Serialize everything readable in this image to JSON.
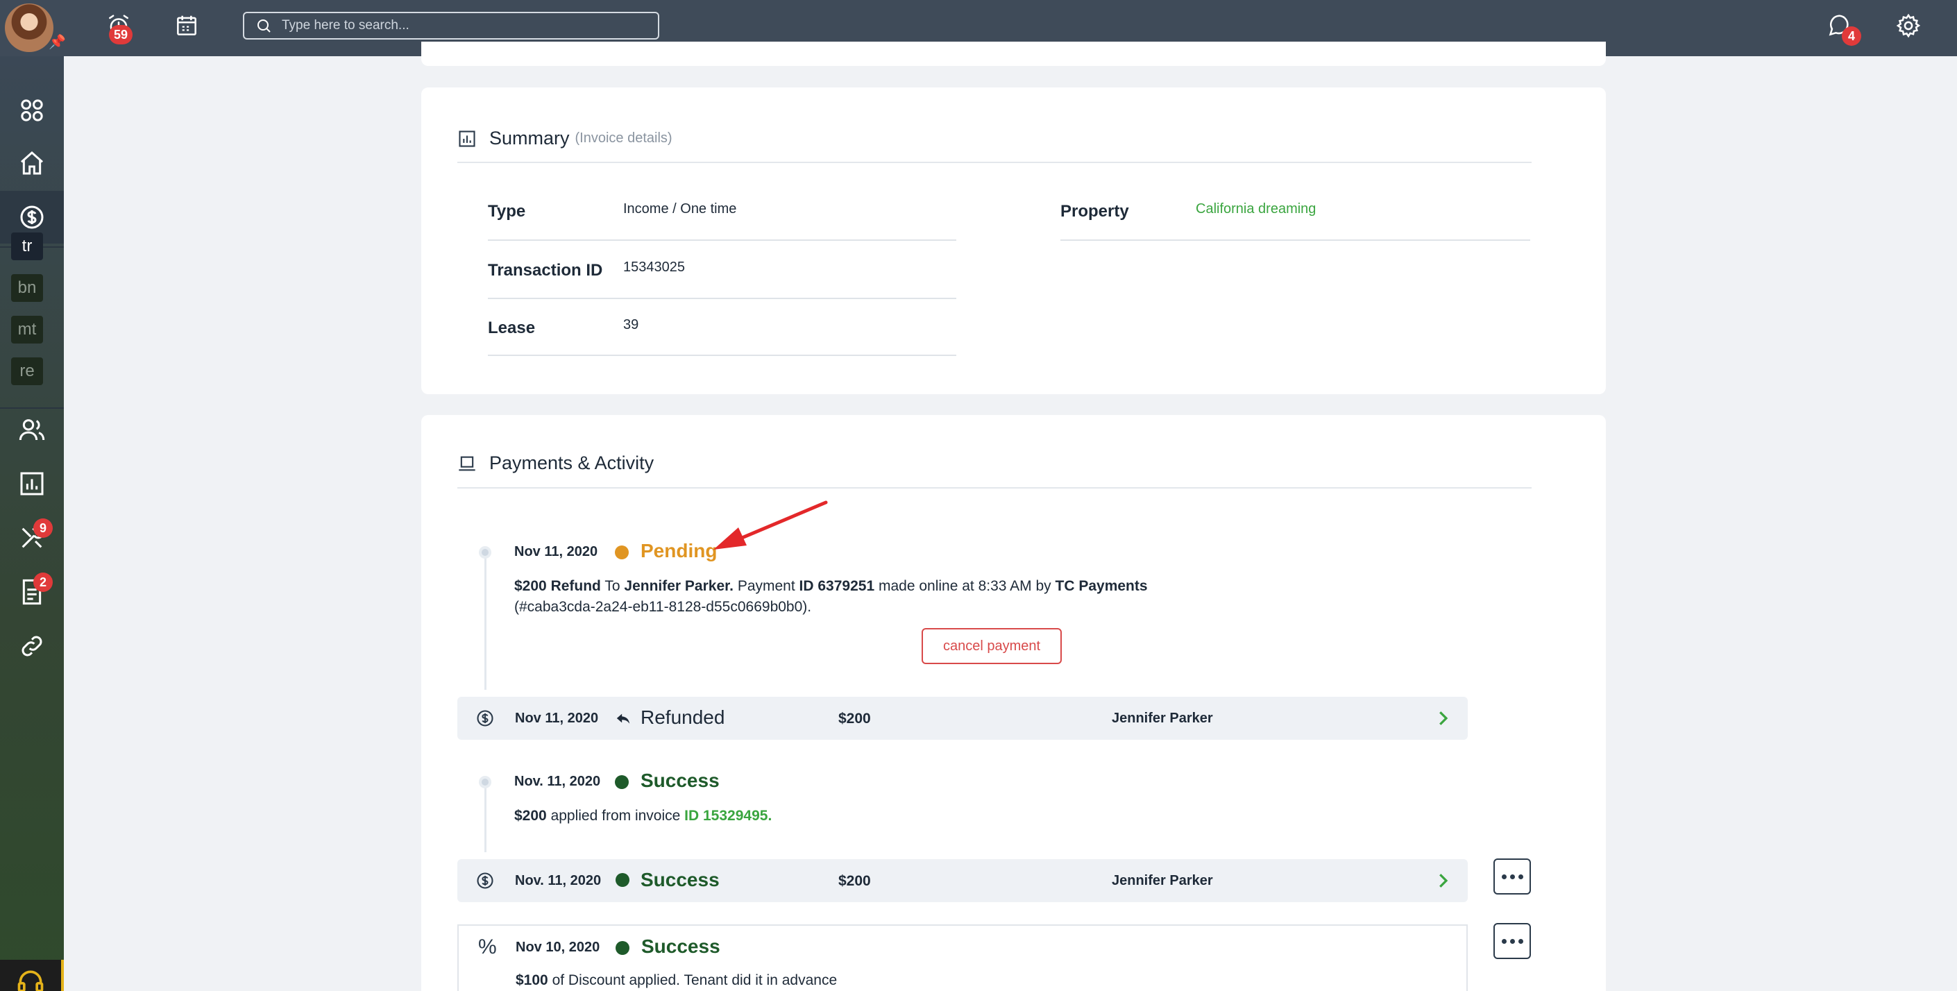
{
  "topbar": {
    "alerts_badge": "59",
    "messages_badge": "4",
    "search_placeholder": "Type here to search..."
  },
  "sidebar": {
    "shortcuts": [
      "tr",
      "bn",
      "mt",
      "re"
    ],
    "maintenance_badge": "9",
    "documents_badge": "2"
  },
  "summary": {
    "title": "Summary",
    "subtitle": "(Invoice details)",
    "type_label": "Type",
    "type_value": "Income / One time",
    "transaction_label": "Transaction ID",
    "transaction_value": "15343025",
    "lease_label": "Lease",
    "lease_value": "39",
    "property_label": "Property",
    "property_value": "California dreaming"
  },
  "payments": {
    "title": "Payments & Activity",
    "pending": {
      "date": "Nov 11, 2020",
      "status": "Pending",
      "amount": "$200",
      "kind": "Refund",
      "to_word": "To",
      "person": "Jennifer Parker.",
      "payment_word": "Payment",
      "payment_id": "ID 6379251",
      "made_text": "made online at 8:33 AM by",
      "processor": "TC Payments",
      "reference": "(#caba3cda-2a24-eb11-8128-d55c0669b0b0).",
      "cancel_label": "cancel payment"
    },
    "refunded_row": {
      "date": "Nov 11, 2020",
      "status": "Refunded",
      "amount": "$200",
      "person": "Jennifer Parker"
    },
    "applied": {
      "date": "Nov. 11, 2020",
      "status": "Success",
      "amount": "$200",
      "text": "applied from invoice",
      "invoice_id": "ID 15329495."
    },
    "success_row": {
      "date": "Nov. 11, 2020",
      "status": "Success",
      "amount": "$200",
      "person": "Jennifer Parker"
    },
    "discount": {
      "date": "Nov 10, 2020",
      "status": "Success",
      "amount": "$100",
      "text": "of Discount applied. Tenant did it in advance"
    }
  },
  "colors": {
    "topbar": "#3f4b59",
    "pending": "#e09522",
    "success": "#1e5a2a",
    "link_green": "#3aa53f",
    "danger": "#d84a4a",
    "annotation_arrow": "#e3282a"
  }
}
